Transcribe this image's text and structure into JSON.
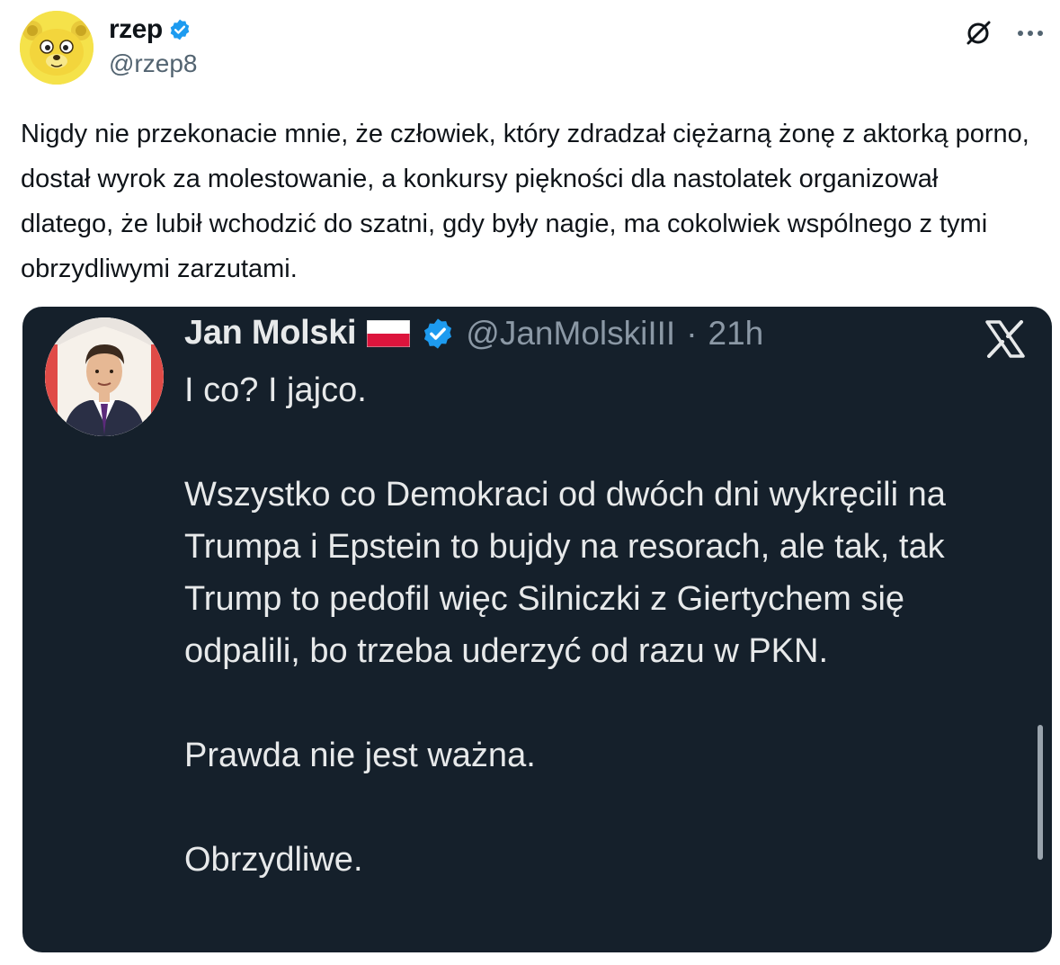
{
  "author": {
    "display_name": "rzep",
    "handle": "@rzep8",
    "avatar_icon": "bear-mascot-avatar",
    "avatar_color": "#f5e24a",
    "verified_color": "#1d9bf0"
  },
  "actions": {
    "grok_icon": "grok-icon",
    "more_icon": "more-dots-icon",
    "more_label": "···"
  },
  "tweet": {
    "text": "Nigdy nie przekonacie mnie, że człowiek, który zdradzał ciężarną żonę z aktorką porno, dostał wyrok za molestowanie, a konkursy piękności dla nastolatek organizował dlatego, że lubił wchodzić do szatni, gdy były nagie, ma cokolwiek wspólnego z tymi obrzydliwymi zarzutami."
  },
  "quoted": {
    "display_name": "Jan Molski",
    "flag_icon": "poland-flag-icon",
    "handle": "@JanMolskiIII",
    "separator": "·",
    "time": "21h",
    "platform_icon": "x-logo-icon",
    "background_color": "#15202b",
    "paragraphs": [
      "I co? I jajco.",
      "Wszystko co Demokraci od dwóch dni wykręcili na Trumpa i Epstein to bujdy na resorach, ale tak, tak Trump to pedofil więc Silniczki z Giertychem się odpalili, bo trzeba uderzyć od razu w PKN.",
      "Prawda nie jest ważna.",
      "Obrzydliwe."
    ]
  }
}
